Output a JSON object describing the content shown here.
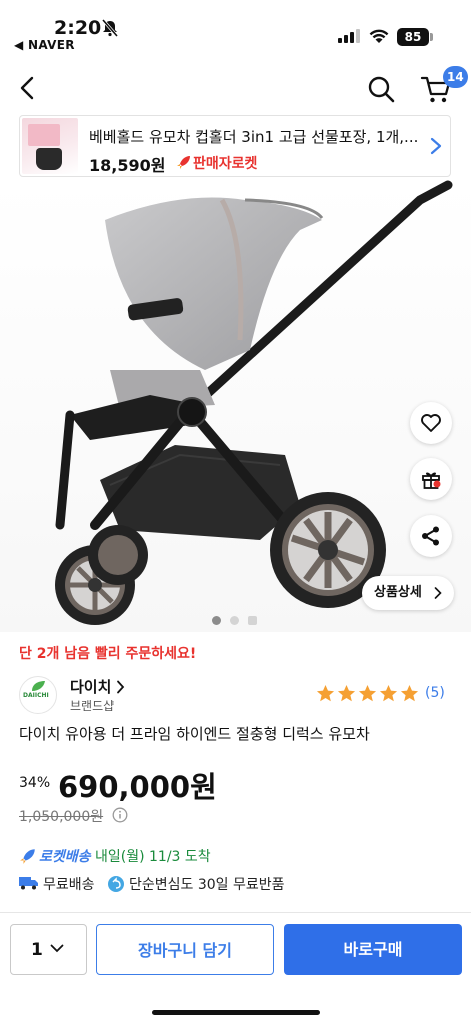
{
  "status_bar": {
    "time": "2:20",
    "back_app": "◀ NAVER",
    "battery": "85",
    "icons": [
      "bell-slash-icon",
      "signal-icon",
      "wifi-icon",
      "battery-icon"
    ]
  },
  "nav": {
    "icons": [
      "back-arrow-icon",
      "search-icon",
      "cart-icon"
    ],
    "cart_count": "14"
  },
  "promo": {
    "title": "베베홀드 유모차 컵홀더 3in1 고급 선물포장, 1개,...",
    "price": "18,590원",
    "seller_badge": "판매자로켓",
    "icons": [
      "rocket-icon",
      "chevron-right-icon"
    ]
  },
  "hero": {
    "side_buttons": [
      "heart-icon",
      "gift-icon",
      "share-icon"
    ],
    "detail_button": "상품상세",
    "carousel_count": 3
  },
  "product": {
    "urgent_notice": "단 2개 남음 빨리 주문하세요!",
    "brand_logo_text": "DAIICHI",
    "brand_name": "다이치",
    "brand_tag": "브랜드샵",
    "rating": 5,
    "review_count": "(5)",
    "name": "다이치 유아용 더 프라임 하이엔드 절충형 디럭스 유모차",
    "discount": "34%",
    "price": "690,000원",
    "original_price": "1,050,000원"
  },
  "shipping": {
    "rocket_label": "로켓배송",
    "eta": "내일(월) 11/3 도착",
    "free_shipping": "무료배송",
    "free_return": "단순변심도 30일 무료반품"
  },
  "bottom_bar": {
    "quantity": "1",
    "add_to_cart": "장바구니 담기",
    "buy_now": "바로구매"
  },
  "colors": {
    "accent_blue": "#2f6fe8",
    "urgent_red": "#e8332f",
    "star_orange": "#f5a033",
    "eta_green": "#1a8b3c"
  }
}
